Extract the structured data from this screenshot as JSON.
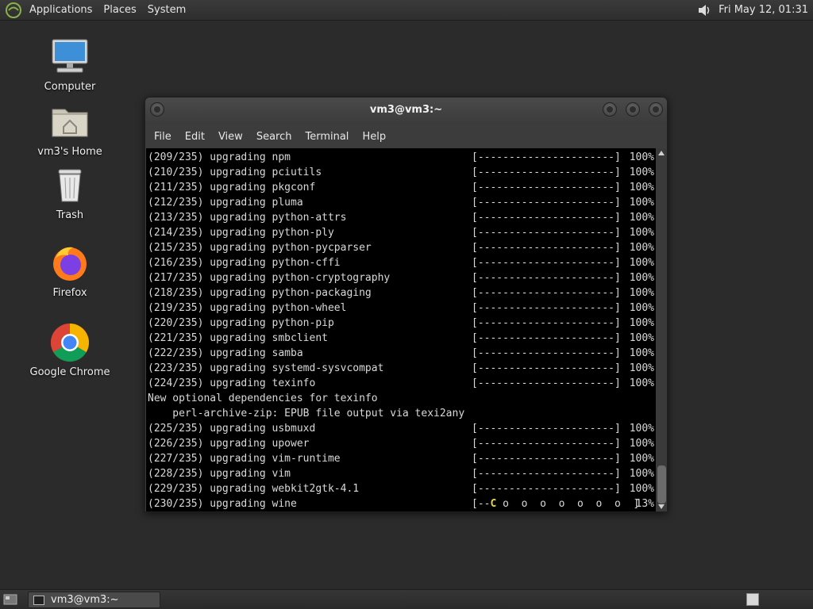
{
  "top_panel": {
    "menus": [
      "Applications",
      "Places",
      "System"
    ],
    "clock": "Fri May 12, 01:31"
  },
  "desktop_icons": [
    {
      "label": "Computer",
      "icon": "computer-icon"
    },
    {
      "label": "vm3's Home",
      "icon": "home-folder-icon"
    },
    {
      "label": "Trash",
      "icon": "trash-icon"
    },
    {
      "label": "Firefox",
      "icon": "firefox-icon"
    },
    {
      "label": "Google Chrome",
      "icon": "chrome-icon"
    }
  ],
  "terminal": {
    "title": "vm3@vm3:~",
    "menus": [
      "File",
      "Edit",
      "View",
      "Search",
      "Terminal",
      "Help"
    ],
    "lines": [
      {
        "text": "(209/235) upgrading npm",
        "bar": "[----------------------]",
        "pct": "100%"
      },
      {
        "text": "(210/235) upgrading pciutils",
        "bar": "[----------------------]",
        "pct": "100%"
      },
      {
        "text": "(211/235) upgrading pkgconf",
        "bar": "[----------------------]",
        "pct": "100%"
      },
      {
        "text": "(212/235) upgrading pluma",
        "bar": "[----------------------]",
        "pct": "100%"
      },
      {
        "text": "(213/235) upgrading python-attrs",
        "bar": "[----------------------]",
        "pct": "100%"
      },
      {
        "text": "(214/235) upgrading python-ply",
        "bar": "[----------------------]",
        "pct": "100%"
      },
      {
        "text": "(215/235) upgrading python-pycparser",
        "bar": "[----------------------]",
        "pct": "100%"
      },
      {
        "text": "(216/235) upgrading python-cffi",
        "bar": "[----------------------]",
        "pct": "100%"
      },
      {
        "text": "(217/235) upgrading python-cryptography",
        "bar": "[----------------------]",
        "pct": "100%"
      },
      {
        "text": "(218/235) upgrading python-packaging",
        "bar": "[----------------------]",
        "pct": "100%"
      },
      {
        "text": "(219/235) upgrading python-wheel",
        "bar": "[----------------------]",
        "pct": "100%"
      },
      {
        "text": "(220/235) upgrading python-pip",
        "bar": "[----------------------]",
        "pct": "100%"
      },
      {
        "text": "(221/235) upgrading smbclient",
        "bar": "[----------------------]",
        "pct": "100%"
      },
      {
        "text": "(222/235) upgrading samba",
        "bar": "[----------------------]",
        "pct": "100%"
      },
      {
        "text": "(223/235) upgrading systemd-sysvcompat",
        "bar": "[----------------------]",
        "pct": "100%"
      },
      {
        "text": "(224/235) upgrading texinfo",
        "bar": "[----------------------]",
        "pct": "100%"
      },
      {
        "text": "New optional dependencies for texinfo",
        "bar": "",
        "pct": ""
      },
      {
        "text": "    perl-archive-zip: EPUB file output via texi2any",
        "bar": "",
        "pct": ""
      },
      {
        "text": "(225/235) upgrading usbmuxd",
        "bar": "[----------------------]",
        "pct": "100%"
      },
      {
        "text": "(226/235) upgrading upower",
        "bar": "[----------------------]",
        "pct": "100%"
      },
      {
        "text": "(227/235) upgrading vim-runtime",
        "bar": "[----------------------]",
        "pct": "100%"
      },
      {
        "text": "(228/235) upgrading vim",
        "bar": "[----------------------]",
        "pct": "100%"
      },
      {
        "text": "(229/235) upgrading webkit2gtk-4.1",
        "bar": "[----------------------]",
        "pct": "100%"
      },
      {
        "text": "(230/235) upgrading wine",
        "bar": "",
        "pct": "13%"
      }
    ],
    "progress_line": {
      "prefix": "[--",
      "pacman": "C",
      "dots": " o  o  o  o  o  o  o  ]",
      "value": 0.13
    }
  },
  "taskbar": {
    "window_button": "vm3@vm3:~"
  }
}
